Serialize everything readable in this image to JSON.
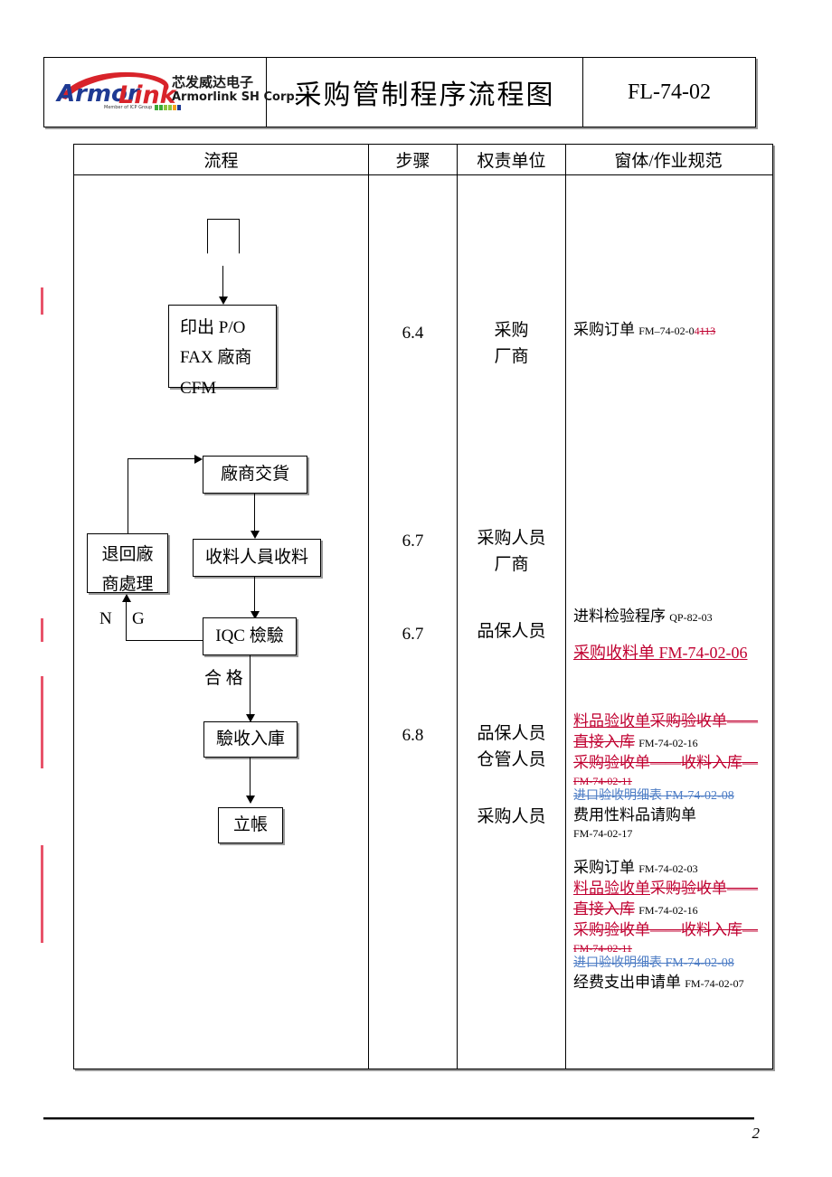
{
  "header": {
    "logo": {
      "word_armor": "Armor",
      "word_link": "Link",
      "cn_name": "芯发威达电子",
      "en_name": "Armorlink SH Corp.",
      "member_text": "Member of ICP Group",
      "color_armor": "#1f3a93",
      "color_link": "#d8232a",
      "color_swoosh": "#d8232a"
    },
    "title": "采购管制程序流程图",
    "doc_no": "FL-74-02"
  },
  "table": {
    "columns": [
      "流程",
      "步骤",
      "权责单位",
      "窗体/作业规范"
    ],
    "flow": {
      "start_connector": "",
      "boxes": {
        "print_po": [
          "印出 P/O",
          "FAX 廠商",
          "CFM"
        ],
        "vendor_delivery": "廠商交貨",
        "receiver_receive": "收料人員收料",
        "return_vendor": [
          "退回廠",
          "商處理"
        ],
        "iqc_inspect": "IQC 檢驗",
        "accept_storage": "驗收入庫",
        "post_account": "立帳"
      },
      "labels": {
        "ng_n": "N",
        "ng_g": "G",
        "pass": "合 格"
      }
    },
    "steps": [
      "6.4",
      "6.7",
      "6.7",
      "6.8"
    ],
    "responsible": [
      [
        "采购",
        "厂商"
      ],
      [
        "采购人员",
        "厂商"
      ],
      [
        "品保人员"
      ],
      [
        "品保人员",
        "仓管人员"
      ],
      [
        "采购人员"
      ]
    ],
    "forms": {
      "group_64": [
        {
          "text": "采购订单",
          "code": "FM–74-02-0",
          "ins": "4",
          "del": "113"
        }
      ],
      "group_67": [
        {
          "text": "进料检验程序",
          "code": "QP-82-03"
        },
        {
          "text": "采购收料单  FM-74-02-06",
          "style": "ins"
        }
      ],
      "group_68": [
        {
          "ins": "料品验收单",
          "del": "采购验收单——"
        },
        {
          "del": "直接入库",
          "code": "FM-74-02-16"
        },
        {
          "del": "采购验收单——收料入库—"
        },
        {
          "del": "FM-74-02-11"
        },
        {
          "delb": "进口验收明细表  FM-74-02-08"
        },
        {
          "text": "费用性料品请购单"
        },
        {
          "code": "FM-74-02-17"
        }
      ],
      "group_purchaser": [
        {
          "text": "采购订单",
          "code": "FM-74-02-03"
        },
        {
          "ins": "料品验收单",
          "del": "采购验收单——"
        },
        {
          "del": "直接入库",
          "code": "FM-74-02-16"
        },
        {
          "del": "采购验收单——收料入库—"
        },
        {
          "del": "FM-74-02-11"
        },
        {
          "delb": "进口验收明细表  FM-74-02-08"
        },
        {
          "text": "经费支出申请单",
          "code": "FM-74-02-07"
        }
      ]
    }
  },
  "footer": {
    "page_number": "2"
  },
  "revision_bars": {
    "color": "#e8536a",
    "count": 4
  }
}
